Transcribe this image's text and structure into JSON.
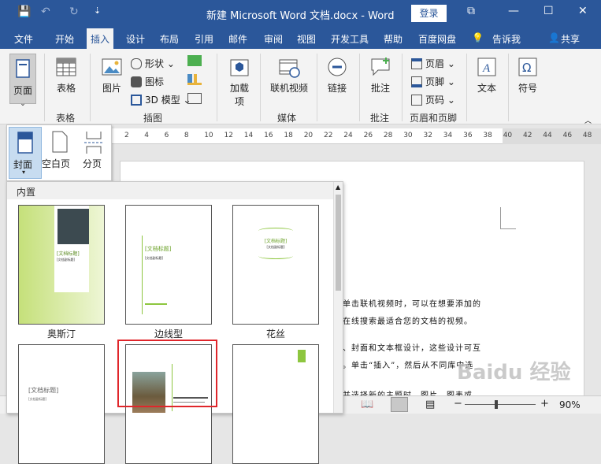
{
  "window": {
    "title": "新建 Microsoft Word 文档.docx  -  Word",
    "login": "登录",
    "save_icon": "💾",
    "undo": "↶",
    "redo": "↻",
    "qa_more": "⇣",
    "min": "—",
    "max": "☐",
    "close": "✕",
    "restore": "⧉"
  },
  "tabs": [
    "文件",
    "开始",
    "插入",
    "设计",
    "布局",
    "引用",
    "邮件",
    "审阅",
    "视图",
    "开发工具",
    "帮助",
    "百度网盘",
    "告诉我",
    "共享"
  ],
  "ribbon": {
    "page": "页面",
    "table": "表格",
    "picture": "图片",
    "shapes": "形状",
    "icons": "图标",
    "model3d": "3D 模型",
    "addin": "加载\n项",
    "online_video": "联机视频",
    "link": "链接",
    "comment": "批注",
    "header": "页眉",
    "footer": "页脚",
    "page_number": "页码",
    "text": "文本",
    "symbol": "符号",
    "group_table": "表格",
    "group_illustrations": "插图",
    "group_media": "媒体",
    "group_comments": "批注",
    "group_header_footer": "页眉和页脚"
  },
  "dropdown": {
    "cover": "封面",
    "blank": "空白页",
    "break": "分页"
  },
  "gallery": {
    "heading": "内置",
    "items": [
      "奥斯汀",
      "边线型",
      "花丝"
    ],
    "doc_title": "[文档标题]",
    "doc_subtitle": "[文档副标题]"
  },
  "ruler": [
    "2",
    "4",
    "6",
    "8",
    "10",
    "12",
    "14",
    "16",
    "18",
    "20",
    "22",
    "24",
    "26",
    "28",
    "30",
    "32",
    "34",
    "36",
    "38",
    "40",
    "42",
    "44",
    "46",
    "48"
  ],
  "doc_lines": [
    "单击联机视频时，可以在想要添加的",
    "在线搜索最适合您的文档的视频。",
    "、封面和文本框设计，这些设计可互",
    "。单击“插入”，然后从不同库中选",
    "并选择新的主题时，图片、图表或"
  ],
  "status": {
    "zoom": "90%",
    "minus": "−",
    "plus": "+"
  },
  "watermark": "Baidu 经验",
  "colors": {
    "brand": "#2b579a",
    "accent_green": "#8dc63f",
    "highlight_red": "#e0262b"
  }
}
